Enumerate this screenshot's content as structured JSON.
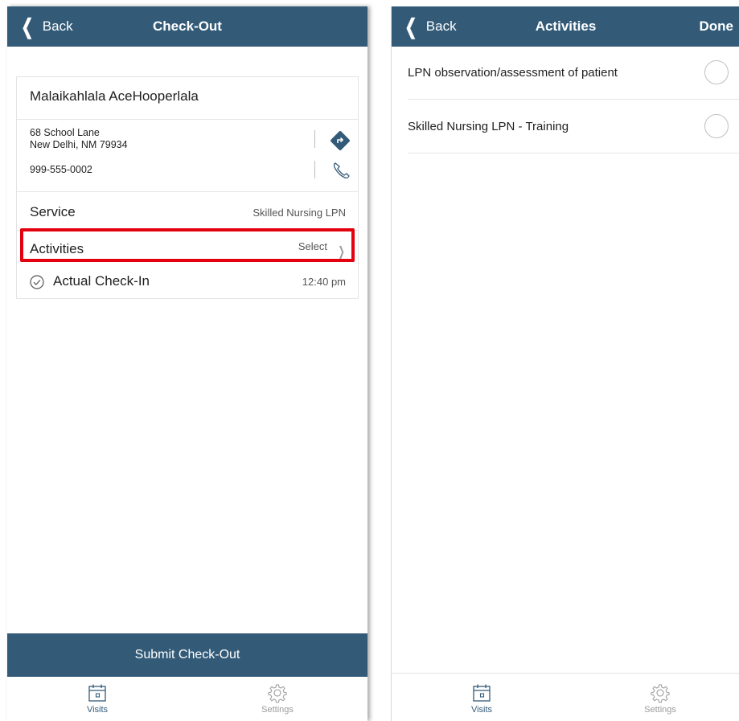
{
  "left": {
    "nav": {
      "back_label": "Back",
      "title": "Check-Out"
    },
    "client": {
      "name": "Malaikahlala AceHooperlala",
      "address_line1": "68 School Lane",
      "address_line2": "New Delhi, NM 79934",
      "phone": "999-555-0002"
    },
    "service": {
      "label": "Service",
      "value": "Skilled Nursing LPN"
    },
    "activities": {
      "label": "Activities",
      "value": "Select"
    },
    "checkin": {
      "label": "Actual Check-In",
      "value": "12:40 pm"
    },
    "submit_label": "Submit Check-Out",
    "highlight_color": "#e3000f"
  },
  "right": {
    "nav": {
      "back_label": "Back",
      "title": "Activities",
      "done_label": "Done"
    },
    "items": [
      {
        "label": "LPN observation/assessment of patient",
        "selected": false
      },
      {
        "label": "Skilled Nursing LPN - Training",
        "selected": false
      }
    ]
  },
  "tabs": [
    {
      "label": "Visits",
      "icon": "calendar-icon",
      "active": true
    },
    {
      "label": "Settings",
      "icon": "gear-icon",
      "active": false
    }
  ],
  "colors": {
    "nav": "#335b78",
    "accent": "#335b78"
  }
}
